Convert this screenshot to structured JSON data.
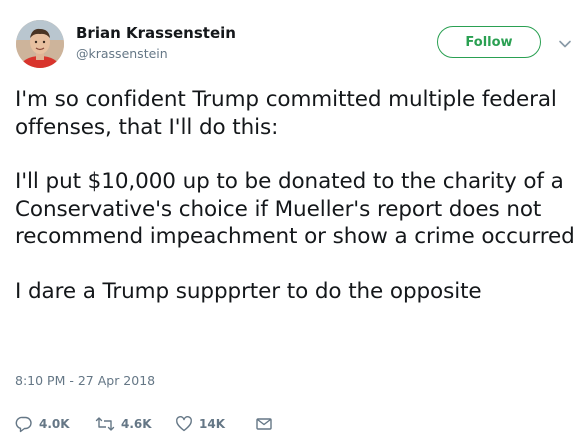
{
  "user": {
    "name": "Brian Krassenstein",
    "handle": "@krassenstein"
  },
  "follow_button": {
    "label": "Follow"
  },
  "tweet": {
    "paragraphs": [
      "I'm so confident Trump committed multiple federal offenses, that I'll do this:",
      "I'll put $10,000 up to be donated to the charity of a Conservative's choice if Mueller's report does not recommend impeachment or show a crime occurred",
      "I dare a Trump suppprter to do the opposite"
    ],
    "timestamp": "8:10 PM - 27 Apr 2018"
  },
  "actions": {
    "replies": "4.0K",
    "retweets": "4.6K",
    "likes": "14K"
  },
  "icons": {
    "reply": "reply-icon",
    "retweet": "retweet-icon",
    "like": "heart-icon",
    "message": "envelope-icon",
    "caret": "chevron-down-icon"
  },
  "colors": {
    "follow_green": "#2aa052",
    "text": "#14171a",
    "secondary": "#657786"
  }
}
